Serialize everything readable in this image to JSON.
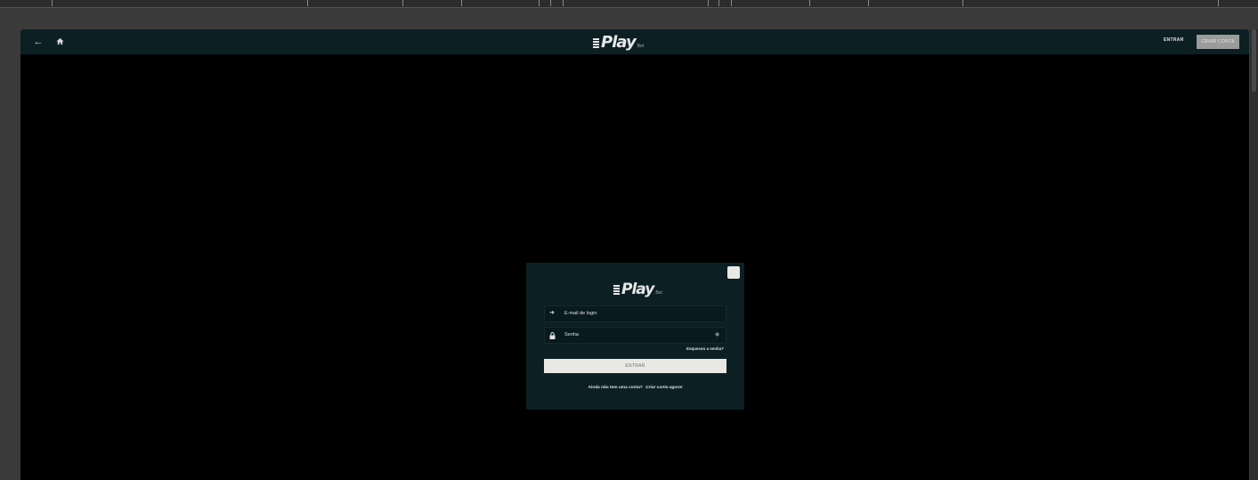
{
  "header": {
    "back_icon": "arrow-left-icon",
    "home_icon": "home-icon",
    "logo": {
      "word": "Play",
      "sub": "Bet"
    },
    "entrar_label": "ENTRAR",
    "criar_label": "CRIAR CONTA"
  },
  "login_modal": {
    "logo": {
      "word": "Play",
      "sub": "Bet"
    },
    "email_placeholder": "E-mail de login",
    "password_placeholder": "Senha",
    "forgot_label": "Esqueceu a senha?",
    "submit_label": "ENTRAR",
    "no_account_text": "Ainda não tem uma conta?",
    "create_link": "Criar conta agora!"
  },
  "colors": {
    "header_bg": "#0c2024",
    "modal_bg": "#0c2024",
    "button_bg": "#e9e8e2",
    "app_bg": "#000000"
  }
}
